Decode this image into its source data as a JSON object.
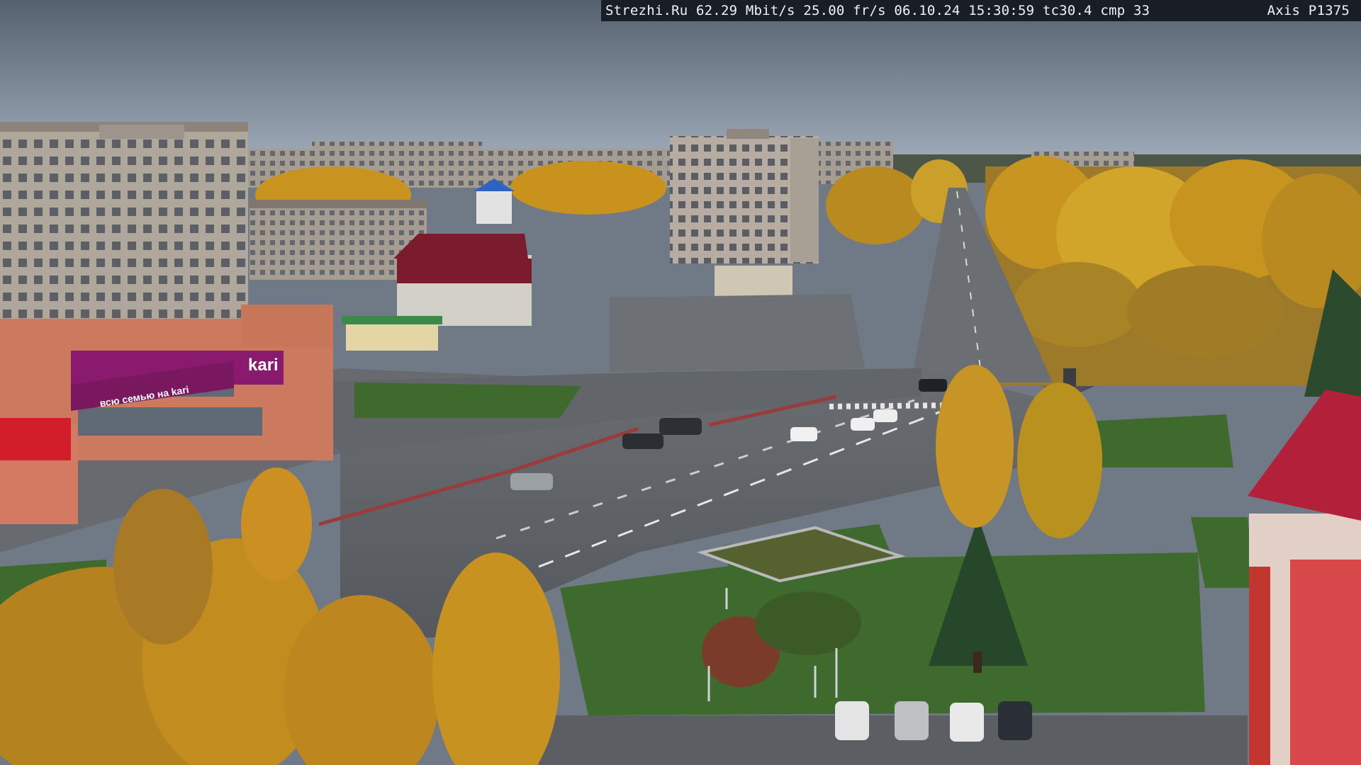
{
  "overlay": {
    "left_text": "Strezhi.Ru 62.29 Mbit/s 25.00 fr/s 06.10.24 15:30:59  tc30.4  cmp 33",
    "camera_model": "Axis P1375"
  },
  "signs": {
    "store_logo": "kari",
    "store_banner": "всю семью на kari"
  },
  "palette": {
    "sky_top": "#5b6778",
    "sky_bottom": "#9aa7b6",
    "asphalt": "#5e6166",
    "grass": "#3f6a2c",
    "autumn_yellow": "#c8921e",
    "building_panel": "#b4aba0",
    "brand_magenta": "#8a1a6e",
    "roof_red": "#b3203a"
  }
}
